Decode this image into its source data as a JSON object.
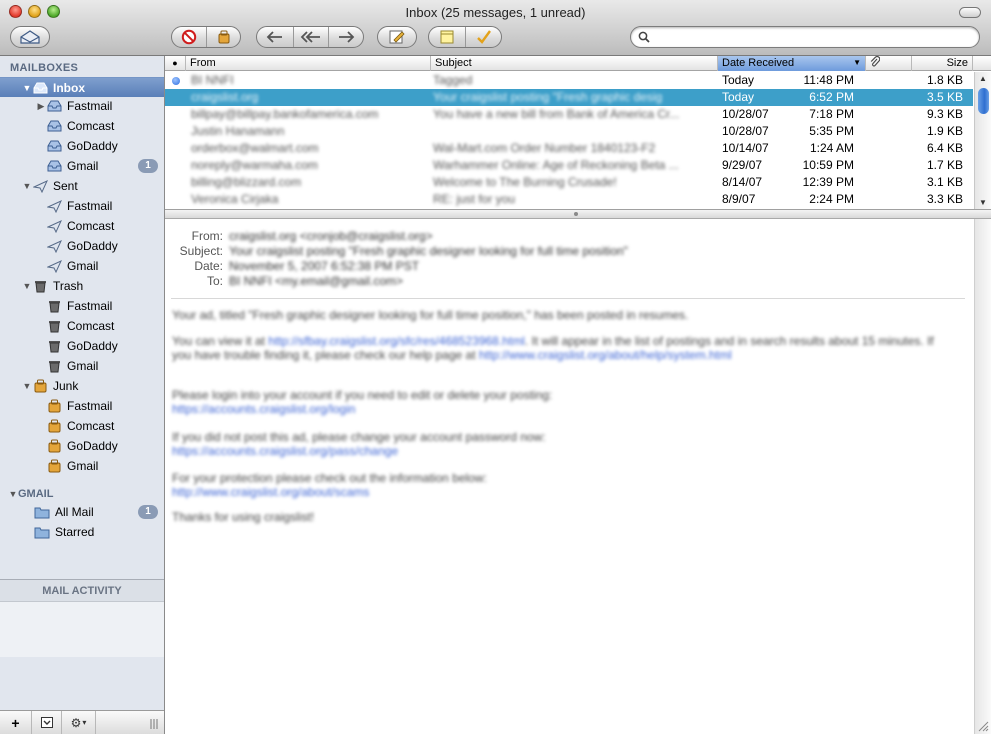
{
  "window": {
    "title": "Inbox (25 messages, 1 unread)"
  },
  "toolbar": {
    "search_value": ""
  },
  "sidebar": {
    "mailboxes_header": "MAILBOXES",
    "gmail_header": "GMAIL",
    "activity_header": "MAIL ACTIVITY",
    "inbox": "Inbox",
    "inbox_accounts": [
      "Fastmail",
      "Comcast",
      "GoDaddy",
      "Gmail"
    ],
    "inbox_gmail_badge": "1",
    "sent": "Sent",
    "sent_accounts": [
      "Fastmail",
      "Comcast",
      "GoDaddy",
      "Gmail"
    ],
    "trash": "Trash",
    "trash_accounts": [
      "Fastmail",
      "Comcast",
      "GoDaddy",
      "Gmail"
    ],
    "junk": "Junk",
    "junk_accounts": [
      "Fastmail",
      "Comcast",
      "GoDaddy",
      "Gmail"
    ],
    "all_mail": "All Mail",
    "all_mail_badge": "1",
    "starred": "Starred",
    "footer_add": "+",
    "footer_gear_caret": "▾"
  },
  "list": {
    "columns": {
      "from": "From",
      "subject": "Subject",
      "date": "Date Received",
      "size": "Size"
    },
    "rows": [
      {
        "from": "BI NNFI",
        "subject": "Tagged",
        "date": "Today",
        "time": "11:48 PM",
        "size": "1.8 KB",
        "unread": true
      },
      {
        "from": "craigslist.org",
        "subject": "Your craigslist posting \"Fresh graphic desig",
        "date": "Today",
        "time": "6:52 PM",
        "size": "3.5 KB",
        "unread": false
      },
      {
        "from": "billpay@billpay.bankofamerica.com",
        "subject": "You have a new bill from Bank of America Cr...",
        "date": "10/28/07",
        "time": "7:18 PM",
        "size": "9.3 KB",
        "unread": false
      },
      {
        "from": "Justin Hanamann",
        "subject": "",
        "date": "10/28/07",
        "time": "5:35 PM",
        "size": "1.9 KB",
        "unread": false
      },
      {
        "from": "orderbox@walmart.com",
        "subject": "Wal-Mart.com Order Number 1840123-F2",
        "date": "10/14/07",
        "time": "1:24 AM",
        "size": "6.4 KB",
        "unread": false
      },
      {
        "from": "noreply@warmaha.com",
        "subject": "Warhammer Online: Age of Reckoning Beta ...",
        "date": "9/29/07",
        "time": "10:59 PM",
        "size": "1.7 KB",
        "unread": false
      },
      {
        "from": "billing@blizzard.com",
        "subject": "Welcome to The Burning Crusade!",
        "date": "8/14/07",
        "time": "12:39 PM",
        "size": "3.1 KB",
        "unread": false
      },
      {
        "from": "Veronica Cirjaka",
        "subject": "RE: just for you",
        "date": "8/9/07",
        "time": "2:24 PM",
        "size": "3.3 KB",
        "unread": false
      }
    ]
  },
  "message": {
    "labels": {
      "from": "From:",
      "subject": "Subject:",
      "date": "Date:",
      "to": "To:"
    },
    "from": "craigslist.org <cronjob@craigslist.org>",
    "subject": "Your craigslist posting \"Fresh graphic designer looking for full time position\"",
    "date": "November 5, 2007 6:52:38 PM PST",
    "to": "BI NNFI <my.email@gmail.com>",
    "body": [
      {
        "text": "Your ad, titled \"Fresh graphic designer looking for full time position,\" has been posted in resumes.",
        "link": ""
      },
      {
        "text": "You can view it at ",
        "link": "http://sfbay.craigslist.org/sfc/res/468523968.html",
        "tail": ". It will appear in the list of postings and in search results about 15 minutes. If"
      },
      {
        "text": "you have trouble finding it, please check our help page at ",
        "link": "http://www.craigslist.org/about/help/system.html",
        "tail": ""
      },
      {
        "text": "Please login into your account if you need to edit or delete your posting:",
        "link": ""
      },
      {
        "text": "",
        "link": "https://accounts.craigslist.org/login"
      },
      {
        "text": "If you did not post this ad, please change your account password now:",
        "link": ""
      },
      {
        "text": "",
        "link": "https://accounts.craigslist.org/pass/change"
      },
      {
        "text": "For your protection please check out the information below:",
        "link": ""
      },
      {
        "text": "",
        "link": "http://www.craigslist.org/about/scams"
      },
      {
        "text": "Thanks for using craigslist!",
        "link": ""
      }
    ]
  }
}
